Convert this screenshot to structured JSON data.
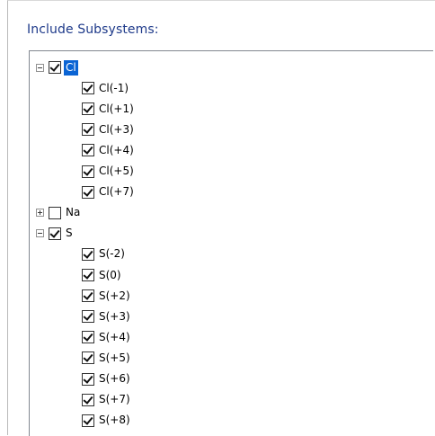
{
  "group": {
    "title": "Include Subsystems:"
  },
  "tree": {
    "nodes": [
      {
        "label": "Cl",
        "checked": true,
        "expanded": true,
        "selected": true,
        "children": [
          "Cl(-1)",
          "Cl(+1)",
          "Cl(+3)",
          "Cl(+4)",
          "Cl(+5)",
          "Cl(+7)"
        ]
      },
      {
        "label": "Na",
        "checked": false,
        "expanded": false,
        "selected": false,
        "children": []
      },
      {
        "label": "S",
        "checked": true,
        "expanded": true,
        "selected": false,
        "children": [
          "S(-2)",
          "S(0)",
          "S(+2)",
          "S(+3)",
          "S(+4)",
          "S(+5)",
          "S(+6)",
          "S(+7)",
          "S(+8)"
        ]
      }
    ]
  },
  "colors": {
    "title": "#1e3a8a",
    "selection": "#0a64d4"
  }
}
